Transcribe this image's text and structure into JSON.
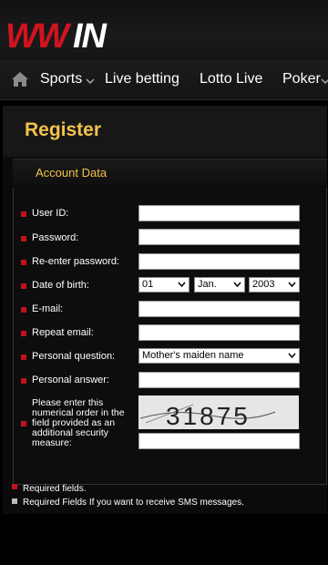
{
  "brand": {
    "logo_text": "WWIN",
    "accent": "#c1121c",
    "gold": "#f2c24a"
  },
  "nav": {
    "home_icon": "home-icon",
    "items": [
      {
        "label": "Sports"
      },
      {
        "label": "Live betting"
      },
      {
        "label": "Lotto Live"
      },
      {
        "label": "Poker"
      }
    ]
  },
  "page": {
    "title": "Register",
    "section": "Account Data"
  },
  "form": {
    "user_id": {
      "label": "User ID:",
      "value": ""
    },
    "password": {
      "label": "Password:",
      "value": ""
    },
    "reenter_password": {
      "label": "Re-enter password:",
      "value": ""
    },
    "dob": {
      "label": "Date of birth:",
      "day": "01",
      "month": "Jan.",
      "year": "2003"
    },
    "email": {
      "label": "E-mail:",
      "value": ""
    },
    "repeat_email": {
      "label": "Repeat email:",
      "value": ""
    },
    "question": {
      "label": "Personal question:",
      "selected": "Mother's maiden name"
    },
    "answer": {
      "label": "Personal answer:",
      "value": ""
    },
    "captcha": {
      "label": "Please enter this numerical order in the field provided as an additional security measure:",
      "code": "31875",
      "value": ""
    }
  },
  "legend": {
    "required": "Required fields.",
    "sms": "Required Fields If you want to receive SMS messages."
  }
}
